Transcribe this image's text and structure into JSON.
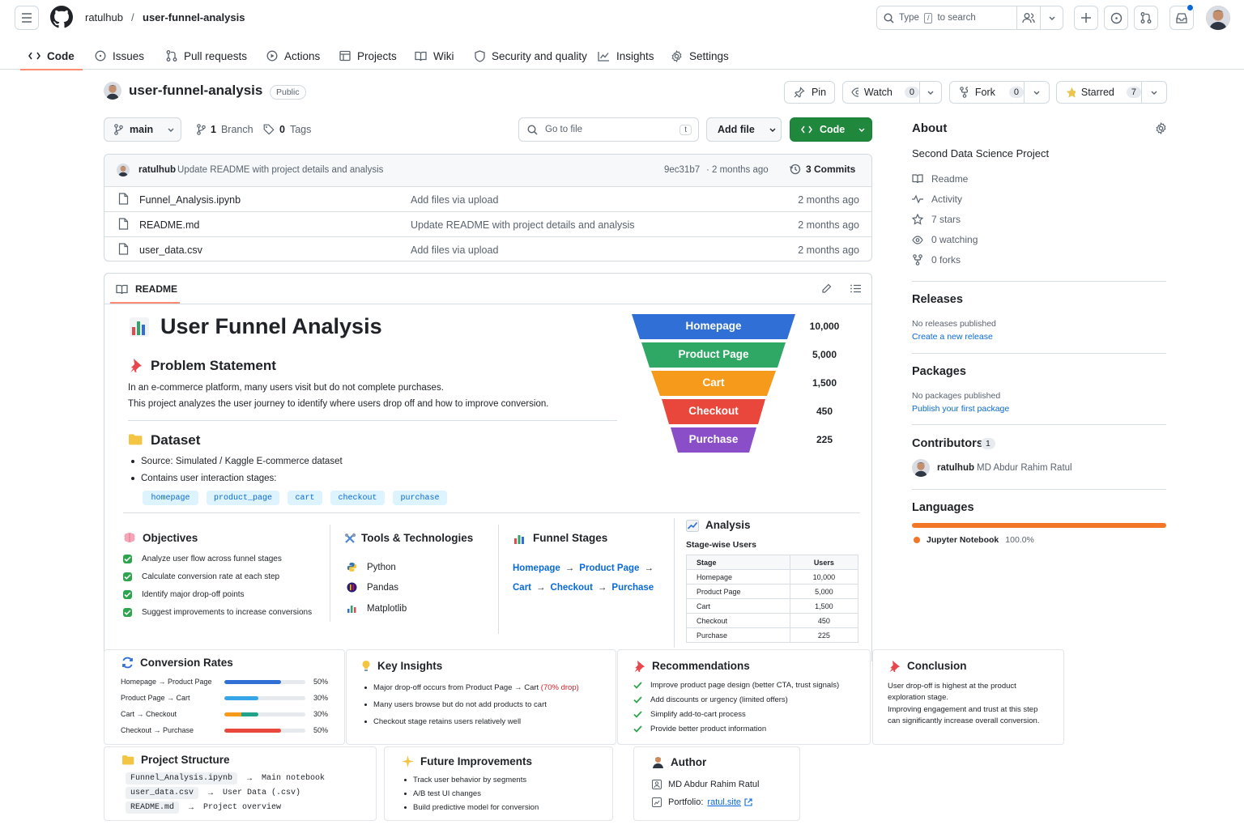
{
  "header": {
    "owner": "ratulhub",
    "separator": "/",
    "repo": "user-funnel-analysis",
    "search_placeholder_pre": "Type",
    "search_key": "/",
    "search_placeholder_post": "to search"
  },
  "tabs": [
    {
      "label": "Code",
      "icon": "code-icon"
    },
    {
      "label": "Issues",
      "icon": "issue-icon"
    },
    {
      "label": "Pull requests",
      "icon": "pull-request-icon"
    },
    {
      "label": "Actions",
      "icon": "play-icon"
    },
    {
      "label": "Projects",
      "icon": "table-icon"
    },
    {
      "label": "Wiki",
      "icon": "book-icon"
    },
    {
      "label": "Security and quality",
      "icon": "shield-icon"
    },
    {
      "label": "Insights",
      "icon": "graph-icon"
    },
    {
      "label": "Settings",
      "icon": "gear-icon"
    }
  ],
  "repo": {
    "name": "user-funnel-analysis",
    "visibility": "Public",
    "pin": "Pin",
    "watch": "Watch",
    "watch_count": "0",
    "fork": "Fork",
    "fork_count": "0",
    "starred": "Starred",
    "star_count": "7"
  },
  "toolbar": {
    "branch": "main",
    "branches": "1",
    "branches_label": "Branch",
    "tags": "0",
    "tags_label": "Tags",
    "go_to_file": "Go to file",
    "go_key": "t",
    "add_file": "Add file",
    "code": "Code"
  },
  "commit": {
    "author": "ratulhub",
    "message": "Update README with project details and analysis",
    "hash": "9ec31b7",
    "dot": "·",
    "time": "2 months ago",
    "count": "3 Commits"
  },
  "files": [
    {
      "name": "Funnel_Analysis.ipynb",
      "message": "Add files via upload",
      "time": "2 months ago"
    },
    {
      "name": "README.md",
      "message": "Update README with project details and analysis",
      "time": "2 months ago"
    },
    {
      "name": "user_data.csv",
      "message": "Add files via upload",
      "time": "2 months ago"
    }
  ],
  "readme": {
    "tab": "README",
    "title": "User Funnel Analysis",
    "problem_heading": "Problem Statement",
    "problem_1": "In an e-commerce platform, many users visit but do not complete purchases.",
    "problem_2": "This project analyzes the user journey to identify where users drop off and how to improve conversion.",
    "dataset_heading": "Dataset",
    "source_label": "Source:",
    "source_value": "Simulated / Kaggle E-commerce dataset",
    "stages_text": "Contains user interaction stages:",
    "chips": [
      "homepage",
      "product_page",
      "cart",
      "checkout",
      "purchase"
    ],
    "funnel": [
      {
        "label": "Homepage",
        "value": "10,000",
        "color": "#2f6fd6"
      },
      {
        "label": "Product Page",
        "value": "5,000",
        "color": "#2fa866"
      },
      {
        "label": "Cart",
        "value": "1,500",
        "color": "#f59a1b"
      },
      {
        "label": "Checkout",
        "value": "450",
        "color": "#e9473b"
      },
      {
        "label": "Purchase",
        "value": "225",
        "color": "#8a4fc8"
      }
    ],
    "objectives_heading": "Objectives",
    "objectives": [
      "Analyze user flow across funnel stages",
      "Calculate conversion rate at each step",
      "Identify major drop-off points",
      "Suggest improvements to increase conversions"
    ],
    "tools_heading": "Tools & Technologies",
    "tools": [
      "Python",
      "Pandas",
      "Matplotlib"
    ],
    "stages_heading": "Funnel Stages",
    "stages_line1": [
      "Homepage",
      "Product Page"
    ],
    "stages_line2": [
      "Cart",
      "Checkout",
      "Purchase"
    ],
    "arrow": "→",
    "analysis_heading": "Analysis",
    "analysis_sub": "Stage-wise Users",
    "table_headers": [
      "Stage",
      "Users"
    ],
    "table_rows": [
      [
        "Homepage",
        "10,000"
      ],
      [
        "Product Page",
        "5,000"
      ],
      [
        "Cart",
        "1,500"
      ],
      [
        "Checkout",
        "450"
      ],
      [
        "Purchase",
        "225"
      ]
    ],
    "conversion_heading": "Conversion Rates",
    "conversions": [
      {
        "label": "Homepage → Product Page",
        "pct": "50%",
        "fill": 0.5
      },
      {
        "label": "Product Page → Cart",
        "pct": "30%",
        "fill": 0.3
      },
      {
        "label": "Cart → Checkout",
        "pct": "30%",
        "fill": 0.3
      },
      {
        "label": "Checkout → Purchase",
        "pct": "50%",
        "fill": 0.5
      }
    ],
    "insights_heading": "Key Insights",
    "insight_1a": "Major drop-off occurs from Product Page → Cart ",
    "insight_1b": "(70% drop)",
    "insight_2": "Many users browse but do not add products to cart",
    "insight_3": "Checkout stage retains users relatively well",
    "rec_heading": "Recommendations",
    "recs": [
      "Improve product page design (better CTA, trust signals)",
      "Add discounts or urgency (limited offers)",
      "Simplify add-to-cart process",
      "Provide better product information"
    ],
    "conclusion_heading": "Conclusion",
    "conclusion_1": "User drop-off is highest at the product exploration stage.",
    "conclusion_2": "Improving engagement and trust at this step can significantly increase overall conversion.",
    "structure_heading": "Project Structure",
    "structure": [
      {
        "file": "Funnel_Analysis.ipynb",
        "desc": "Main notebook"
      },
      {
        "file": "user_data.csv",
        "desc": "User Data (.csv)"
      },
      {
        "file": "README.md",
        "desc": "Project overview"
      }
    ],
    "future_heading": "Future Improvements",
    "future": [
      "Track user behavior by segments",
      "A/B test UI changes",
      "Build predictive model for conversion"
    ],
    "author_heading": "Author",
    "author_name": "MD Abdur Rahim Ratul",
    "portfolio_label": "Portfolio:",
    "portfolio_link": "ratul.site"
  },
  "sidebar": {
    "about": "About",
    "description": "Second Data Science Project",
    "items": [
      {
        "label": "Readme",
        "icon": "book-icon"
      },
      {
        "label": "Activity",
        "icon": "pulse-icon"
      },
      {
        "label": "7 stars",
        "icon": "star-icon"
      },
      {
        "label": "0 watching",
        "icon": "eye-icon"
      },
      {
        "label": "0 forks",
        "icon": "fork-icon"
      }
    ],
    "releases": "Releases",
    "no_releases": "No releases published",
    "create_release": "Create a new release",
    "packages": "Packages",
    "no_packages": "No packages published",
    "publish_package": "Publish your first package",
    "contributors": "Contributors",
    "contributors_count": "1",
    "contributor_login": "ratulhub",
    "contributor_name": "MD Abdur Rahim Ratul",
    "languages": "Languages",
    "language": "Jupyter Notebook",
    "language_pct": "100.0%",
    "language_color": "#f37626"
  }
}
